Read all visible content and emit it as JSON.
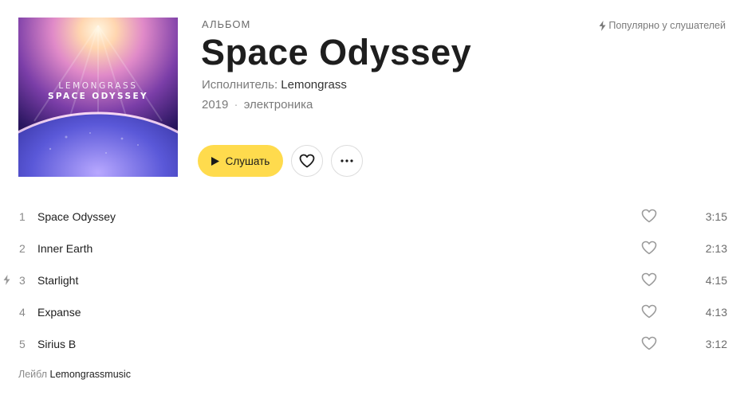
{
  "cover": {
    "artist_text": "LEMONGRASS",
    "album_text": "SPACE ODYSSEY"
  },
  "album": {
    "type_label": "АЛЬБОМ",
    "title": "Space Odyssey",
    "artist_prefix": "Исполнитель: ",
    "artist": "Lemongrass",
    "year": "2019",
    "separator": "·",
    "genre": "электроника"
  },
  "popular_badge": {
    "icon": "lightning-icon",
    "text": "Популярно у слушателей"
  },
  "actions": {
    "play_label": "Слушать",
    "play_icon": "play-icon",
    "like_icon": "heart-icon",
    "more_icon": "more-icon"
  },
  "tracks": [
    {
      "number": "1",
      "title": "Space Odyssey",
      "duration": "3:15",
      "popular": false
    },
    {
      "number": "2",
      "title": "Inner Earth",
      "duration": "2:13",
      "popular": false
    },
    {
      "number": "3",
      "title": "Starlight",
      "duration": "4:15",
      "popular": true
    },
    {
      "number": "4",
      "title": "Expanse",
      "duration": "4:13",
      "popular": false
    },
    {
      "number": "5",
      "title": "Sirius B",
      "duration": "3:12",
      "popular": false
    }
  ],
  "footer": {
    "label_prefix": "Лейбл",
    "label_value": "Lemongrassmusic"
  },
  "colors": {
    "accent": "#ffdb4d",
    "text": "#1e1e1e",
    "muted": "#7a7a7a"
  }
}
